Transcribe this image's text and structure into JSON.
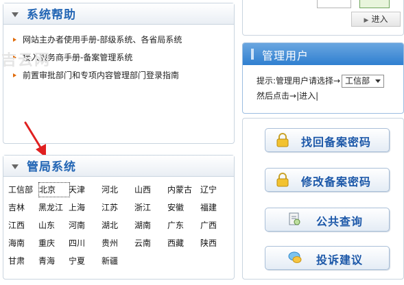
{
  "help": {
    "title": "系统帮助",
    "items": [
      "网站主办者使用手册-部级系统、各省局系统",
      "接入服务商手册-备案管理系统",
      "前置审批部门和专项内容管理部门登录指南"
    ]
  },
  "watermark": "吉云网",
  "provinces": {
    "title": "管局系统",
    "rows": [
      [
        "工信部",
        "北京",
        "天津",
        "河北",
        "山西",
        "内蒙古",
        "辽宁"
      ],
      [
        "吉林",
        "黑龙江",
        "上海",
        "江苏",
        "浙江",
        "安徽",
        "福建"
      ],
      [
        "江西",
        "山东",
        "河南",
        "湖北",
        "湖南",
        "广东",
        "广西"
      ],
      [
        "海南",
        "重庆",
        "四川",
        "贵州",
        "云南",
        "西藏",
        "陕西"
      ],
      [
        "甘肃",
        "青海",
        "宁夏",
        "新疆"
      ]
    ]
  },
  "login": {
    "button_label": "进入"
  },
  "admin": {
    "title": "管理用户",
    "prompt": "提示:管理用户请选择→",
    "selected": "工信部",
    "then_click": "然后点击→",
    "enter_link": "|进入|"
  },
  "services": {
    "buttons": [
      {
        "label": "找回备案密码",
        "icon": "lock-icon"
      },
      {
        "label": "修改备案密码",
        "icon": "lock-icon"
      },
      {
        "label": "公共查询",
        "icon": "search-doc-icon"
      },
      {
        "label": "投诉建议",
        "icon": "chat-icon"
      }
    ]
  },
  "colors": {
    "accent": "#2265b4",
    "admin_header": "#2f7fd0",
    "bullet": "#e06b0a",
    "arrow": "#e02020"
  }
}
